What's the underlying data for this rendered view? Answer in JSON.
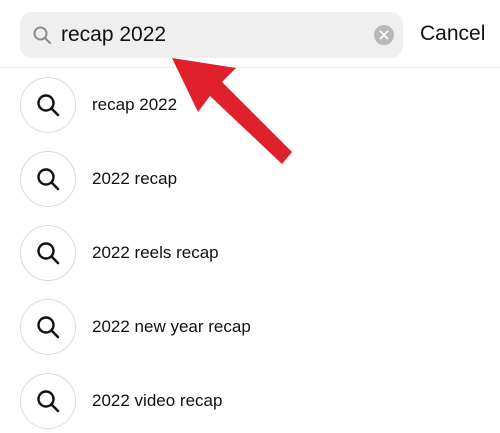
{
  "search": {
    "value": "recap 2022",
    "cancel_label": "Cancel",
    "lead_icon": "search-icon",
    "clear_icon": "clear-icon"
  },
  "suggestions": [
    {
      "label": "recap 2022",
      "icon": "search-icon"
    },
    {
      "label": "2022 recap",
      "icon": "search-icon"
    },
    {
      "label": "2022 reels recap",
      "icon": "search-icon"
    },
    {
      "label": "2022 new year recap",
      "icon": "search-icon"
    },
    {
      "label": "2022 video recap",
      "icon": "search-icon"
    }
  ],
  "annotation": {
    "type": "arrow",
    "color": "#e0202a"
  }
}
